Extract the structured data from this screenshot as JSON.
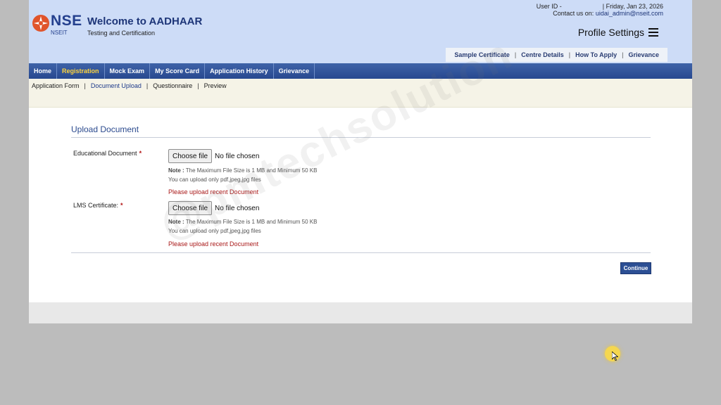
{
  "header": {
    "logo_text": "NSE",
    "logo_subtext": "NSEIT",
    "title": "Welcome to AADHAAR",
    "subtitle": "Testing and Certification",
    "user_id_label": "User ID -",
    "date_text": "| Friday, Jan 23, 2026",
    "contact_label": "Contact us on:",
    "contact_email": "uidai_admin@nseit.com",
    "profile_settings": "Profile Settings",
    "quick_links": [
      "Sample Certificate",
      "Centre Details",
      "How To Apply",
      "Grievance"
    ]
  },
  "nav": {
    "items": [
      "Home",
      "Registration",
      "Mock Exam",
      "My Score Card",
      "Application History",
      "Grievance"
    ],
    "active": "Registration"
  },
  "subnav": {
    "items": [
      "Application Form",
      "Document Upload",
      "Questionnaire",
      "Preview"
    ],
    "current": "Document Upload"
  },
  "upload": {
    "section_title": "Upload Document",
    "fields": [
      {
        "label": "Educational Document",
        "required_mark": "*",
        "button": "Choose file",
        "status": "No file chosen",
        "note_prefix": "Note :",
        "note_text": "The Maximum File Size is 1 MB and Minimum 50 KB",
        "allowed_types": "You can upload only pdf,jpeg,jpg files",
        "error": "Please upload recent Document"
      },
      {
        "label": "LMS Certificate:",
        "required_mark": "*",
        "button": "Choose file",
        "status": "No file chosen",
        "note_prefix": "Note :",
        "note_text": "The Maximum File Size is 1 MB and Minimum 50 KB",
        "allowed_types": "You can upload only pdf,jpeg,jpg files",
        "error": "Please upload recent Document"
      }
    ],
    "continue_label": "Continue"
  },
  "watermark": "@pmtechsolution",
  "colors": {
    "header_bg": "#cddcf7",
    "nav_bg": "#2f519a",
    "nav_active": "#ffd43b",
    "error": "#a91818",
    "button": "#2c4f94"
  }
}
